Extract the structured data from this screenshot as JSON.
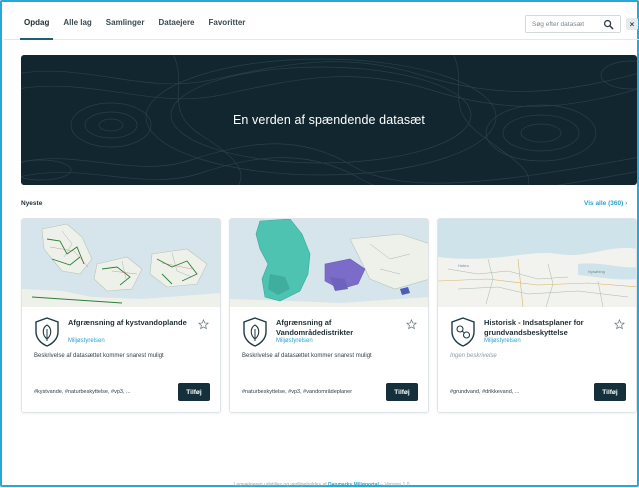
{
  "nav": {
    "tabs": [
      {
        "label": "Opdag",
        "active": true
      },
      {
        "label": "Alle lag",
        "active": false
      },
      {
        "label": "Samlinger",
        "active": false
      },
      {
        "label": "Dataejere",
        "active": false
      },
      {
        "label": "Favoritter",
        "active": false
      }
    ],
    "search_placeholder": "Søg efter datasæt",
    "search_icon": "search-icon",
    "close_label": "×"
  },
  "hero": {
    "title": "En verden af spændende datasæt"
  },
  "section": {
    "label": "Nyeste",
    "see_all": "Vis alle (360) ›"
  },
  "cards": [
    {
      "title": "Afgrænsning af kystvandoplande",
      "publisher": "Miljøstyrelsen",
      "description": "Beskrivelse af datasættet kommer snarest muligt",
      "tags": "#kystvande, #naturbeskyttelse, #vp3, ...",
      "add_label": "Tilføj",
      "icon": "leaf-shield-icon"
    },
    {
      "title": "Afgrænsning af Vandområdedistrikter",
      "publisher": "Miljøstyrelsen",
      "description": "Beskrivelse af datasættet kommer snarest muligt",
      "tags": "#naturbeskyttelse, #vp3, #vandområdeplaner",
      "add_label": "Tilføj",
      "icon": "leaf-shield-icon"
    },
    {
      "title": "Historisk - Indsatsplaner for grundvandsbeskyttelse",
      "publisher": "Miljøstyrelsen",
      "description": "Ingen beskrivelse",
      "tags": "#grundvand, #drikkevand, ...",
      "add_label": "Tilføj",
      "icon": "molecule-shield-icon"
    }
  ],
  "footer": {
    "prefix": "Lagvælgeren udstilles og vedligeholdes af",
    "link": "Danmarks Miljøportal",
    "suffix": "– Version 1.0"
  },
  "colors": {
    "accent": "#2aa3cf",
    "hero_bg": "#12262f",
    "button_bg": "#14303b",
    "frame": "#29a8d8"
  }
}
